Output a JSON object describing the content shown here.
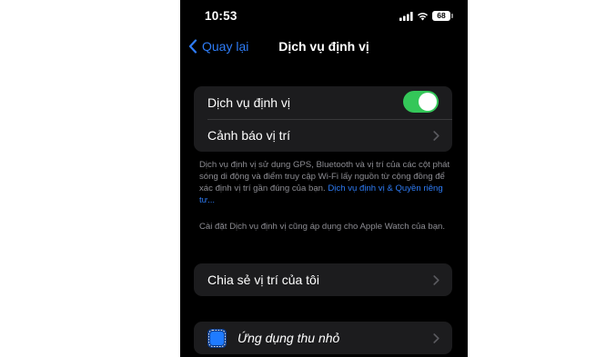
{
  "status_bar": {
    "time": "10:53",
    "battery": "68"
  },
  "nav": {
    "back_label": "Quay lại",
    "title": "Dịch vụ định vị"
  },
  "location_group": {
    "location_services_label": "Dịch vụ định vị",
    "location_services_on": true,
    "location_alerts_label": "Cảnh báo vị trí"
  },
  "footnote": {
    "description": "Dịch vụ định vị sử dụng GPS, Bluetooth và vị trí của các cột phát sóng di động và điểm truy cập Wi-Fi lấy nguồn từ cộng đồng để xác định vị trí gần đúng của bạn. ",
    "link": "Dịch vụ định vị & Quyền riêng tư...",
    "watch_note": "Cài đặt Dịch vụ định vị cũng áp dụng cho Apple Watch của bạn."
  },
  "share_group": {
    "share_my_location_label": "Chia sẻ vị trí của tôi"
  },
  "apps_group": {
    "app_clips_label": "Ứng dụng thu nhỏ",
    "app_clips_icon": "app-clips-icon"
  },
  "colors": {
    "accent": "#2e7cf6",
    "toggle_on": "#34c759",
    "cell_background": "#1c1c1e",
    "screen_background": "#000000"
  }
}
